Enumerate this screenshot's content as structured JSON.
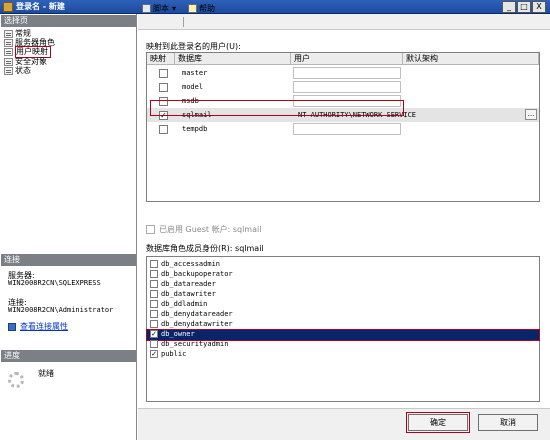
{
  "window": {
    "title": "登录名 - 新建",
    "buttons": {
      "minimize": "_",
      "maximize": "□",
      "close": "X"
    }
  },
  "left_panel": {
    "select_page_header": "选择页",
    "pages": [
      "常规",
      "服务器角色",
      "用户映射",
      "安全对象",
      "状态"
    ],
    "selected_page": "用户映射",
    "connection_header": "连接",
    "server_label": "服务器:",
    "server_value": "WIN2008R2CN\\SQLEXPRESS",
    "connection_label": "连接:",
    "connection_value": "WIN2008R2CN\\Administrator",
    "view_connection_link": "查看连接属性",
    "progress_header": "进度",
    "progress_status": "就绪"
  },
  "toolbar": {
    "script_label": "脚本",
    "script_dropdown": "▾",
    "help_label": "帮助"
  },
  "mapping": {
    "label": "映射到此登录名的用户(U):",
    "columns": [
      "映射",
      "数据库",
      "用户",
      "默认架构"
    ],
    "rows": [
      {
        "checked": false,
        "database": "master",
        "user": "",
        "schema": ""
      },
      {
        "checked": false,
        "database": "model",
        "user": "",
        "schema": ""
      },
      {
        "checked": false,
        "database": "msdb",
        "user": "",
        "schema": ""
      },
      {
        "checked": true,
        "database": "sqlmail",
        "user": "NT AUTHORITY\\NETWORK SERVICE",
        "schema": ""
      },
      {
        "checked": false,
        "database": "tempdb",
        "user": "",
        "schema": ""
      }
    ],
    "ellipsis_button": "..."
  },
  "guest": {
    "label": "已启用 Guest 帐户: sqlmail",
    "checked": false
  },
  "roles": {
    "label": "数据库角色成员身份(R): sqlmail",
    "items": [
      {
        "name": "db_accessadmin",
        "checked": false
      },
      {
        "name": "db_backupoperator",
        "checked": false
      },
      {
        "name": "db_datareader",
        "checked": false
      },
      {
        "name": "db_datawriter",
        "checked": false
      },
      {
        "name": "db_ddladmin",
        "checked": false
      },
      {
        "name": "db_denydatareader",
        "checked": false
      },
      {
        "name": "db_denydatawriter",
        "checked": false
      },
      {
        "name": "db_owner",
        "checked": true
      },
      {
        "name": "db_securityadmin",
        "checked": false
      },
      {
        "name": "public",
        "checked": true
      }
    ]
  },
  "footer": {
    "ok_label": "确定",
    "cancel_label": "取消"
  },
  "colors": {
    "title_bar": "#2e62b8",
    "highlight_box": "#b00020",
    "selection": "#0a246a"
  }
}
